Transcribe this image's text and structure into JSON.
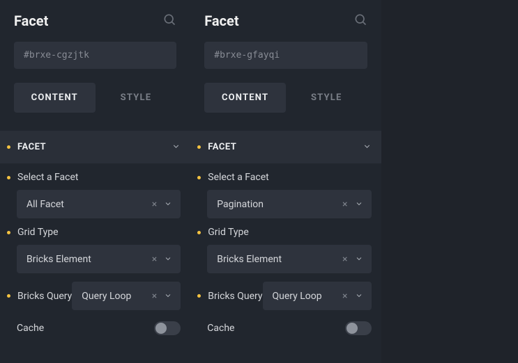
{
  "panels": [
    {
      "title": "Facet",
      "css_selector": "#brxe-cgzjtk",
      "tabs": {
        "content": "CONTENT",
        "style": "STYLE"
      },
      "section_title": "FACET",
      "select_facet_label": "Select a Facet",
      "select_facet_value": "All Facet",
      "grid_type_label": "Grid Type",
      "grid_type_value": "Bricks Element",
      "bricks_query_label": "Bricks Query",
      "bricks_query_value": "Query Loop",
      "cache_label": "Cache"
    },
    {
      "title": "Facet",
      "css_selector": "#brxe-gfayqi",
      "tabs": {
        "content": "CONTENT",
        "style": "STYLE"
      },
      "section_title": "FACET",
      "select_facet_label": "Select a Facet",
      "select_facet_value": "Pagination",
      "grid_type_label": "Grid Type",
      "grid_type_value": "Bricks Element",
      "bricks_query_label": "Bricks Query",
      "bricks_query_value": "Query Loop",
      "cache_label": "Cache"
    }
  ]
}
